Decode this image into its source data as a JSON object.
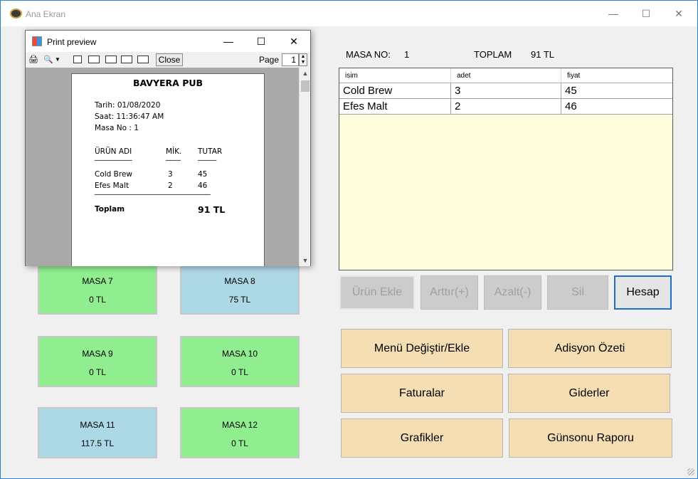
{
  "window": {
    "title": "Ana Ekran",
    "minimize": "—",
    "maximize": "☐",
    "close": "✕"
  },
  "tables": [
    {
      "name": "MASA 7",
      "total": "0  TL",
      "color": "#90ee90"
    },
    {
      "name": "MASA 8",
      "total": "75  TL",
      "color": "#add8e6"
    },
    {
      "name": "MASA 9",
      "total": "0  TL",
      "color": "#90ee90"
    },
    {
      "name": "MASA 10",
      "total": "0  TL",
      "color": "#90ee90"
    },
    {
      "name": "MASA 11",
      "total": "117.5  TL",
      "color": "#add8e6"
    },
    {
      "name": "MASA 12",
      "total": "0  TL",
      "color": "#90ee90"
    }
  ],
  "header": {
    "masa_no_label": "MASA NO:",
    "masa_no_value": "1",
    "toplam_label": "TOPLAM",
    "toplam_value": "91 TL"
  },
  "order_grid": {
    "columns": [
      "isim",
      "adet",
      "fiyat"
    ],
    "rows": [
      [
        "Cold Brew",
        "3",
        "45"
      ],
      [
        "Efes Malt",
        "2",
        "46"
      ]
    ]
  },
  "actions": {
    "urun_ekle": "Ürün Ekle",
    "arttir": "Arttır(+)",
    "azalt": "Azalt(-)",
    "sil": "Sil",
    "hesap": "Hesap"
  },
  "menu": {
    "menu_degistir": "Menü Değiştir/Ekle",
    "adisyon_ozeti": "Adisyon Özeti",
    "faturalar": "Faturalar",
    "giderler": "Giderler",
    "grafikler": "Grafikler",
    "gunsonu": "Günsonu Raporu"
  },
  "print_preview": {
    "title": "Print preview",
    "close_label": "Close",
    "page_label": "Page",
    "page_value": "1",
    "receipt": {
      "pub_name": "BAVYERA PUB",
      "tarih": "Tarih: 01/08/2020",
      "saat": "Saat: 11:36:47 AM",
      "masa": "Masa No : 1",
      "col_urun": "ÜRÜN ADI",
      "col_mik": "MİK.",
      "col_tutar": "TUTAR",
      "sep_urun": "__________",
      "sep_mik": "____",
      "sep_tutar": "_____",
      "items": [
        {
          "name": "Cold Brew",
          "qty": "3",
          "amount": "45"
        },
        {
          "name": "Efes Malt",
          "qty": "2",
          "amount": "46"
        }
      ],
      "separator": "_______________________________",
      "toplam_label": "Toplam",
      "toplam_value": "91 TL"
    }
  }
}
